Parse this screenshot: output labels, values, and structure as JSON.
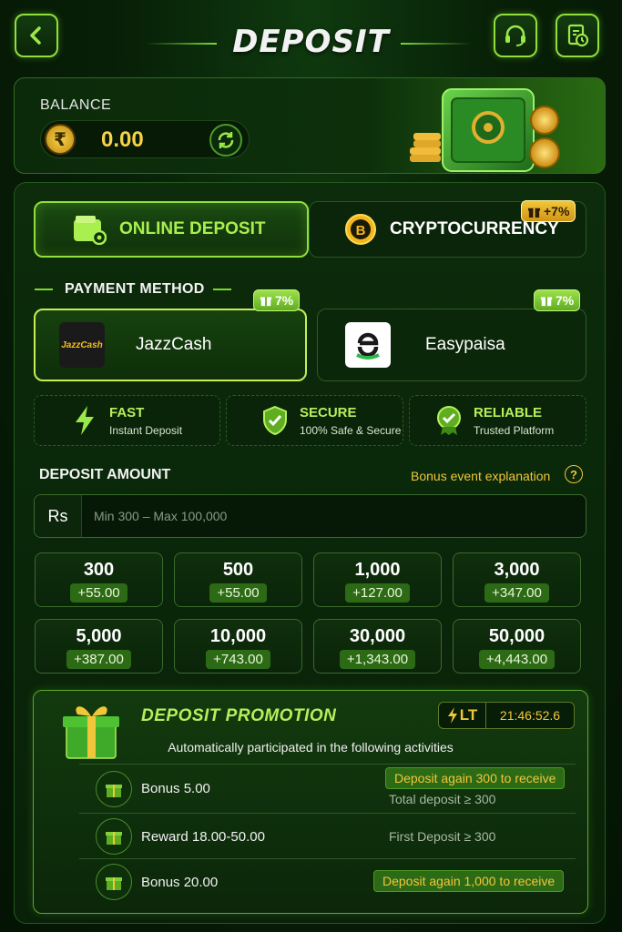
{
  "header": {
    "title": "DEPOSIT",
    "icons": {
      "back": "chevron-left-icon",
      "support": "headset-icon",
      "records": "document-clock-icon"
    }
  },
  "balance": {
    "label": "BALANCE",
    "value": "0.00",
    "currency_symbol": "₹"
  },
  "tabs": [
    {
      "label": "ONLINE DEPOSIT",
      "active": true
    },
    {
      "label": "CRYPTOCURRENCY",
      "active": false,
      "badge": "+7%"
    }
  ],
  "payment_method": {
    "title": "PAYMENT METHOD",
    "methods": [
      {
        "name": "JazzCash",
        "badge": "7%",
        "logo_text": "JazzCash",
        "selected": true
      },
      {
        "name": "Easypaisa",
        "badge": "7%",
        "selected": false
      }
    ]
  },
  "features": [
    {
      "title": "FAST",
      "subtitle": "Instant Deposit",
      "icon": "lightning-icon"
    },
    {
      "title": "SECURE",
      "subtitle": "100% Safe & Secure",
      "icon": "shield-check-icon"
    },
    {
      "title": "RELIABLE",
      "subtitle": "Trusted Platform",
      "icon": "badge-check-icon"
    }
  ],
  "deposit_amount": {
    "title": "DEPOSIT AMOUNT",
    "bonus_link": "Bonus event explanation",
    "help_symbol": "?",
    "currency_label": "Rs",
    "placeholder": "Min 300 – Max 100,000",
    "chips": [
      {
        "amount": "300",
        "bonus": "+55.00"
      },
      {
        "amount": "500",
        "bonus": "+55.00"
      },
      {
        "amount": "1,000",
        "bonus": "+127.00"
      },
      {
        "amount": "3,000",
        "bonus": "+347.00"
      },
      {
        "amount": "5,000",
        "bonus": "+387.00"
      },
      {
        "amount": "10,000",
        "bonus": "+743.00"
      },
      {
        "amount": "30,000",
        "bonus": "+1,343.00"
      },
      {
        "amount": "50,000",
        "bonus": "+4,443.00"
      }
    ]
  },
  "promotion": {
    "title": "DEPOSIT PROMOTION",
    "lt_label": "LT",
    "countdown": "21:46:52.6",
    "subtitle": "Automatically participated in the following activities",
    "rows": [
      {
        "label": "Bonus 5.00",
        "cta": "Deposit again 300 to receive",
        "condition": "Total deposit ≥ 300"
      },
      {
        "label": "Reward 18.00-50.00",
        "cta": "",
        "condition": "First Deposit ≥ 300"
      },
      {
        "label": "Bonus 20.00",
        "cta": "Deposit again 1,000 to receive",
        "condition": ""
      }
    ]
  },
  "colors": {
    "accent_green": "#8fe03a",
    "gold": "#f2c63a",
    "background": "#071f07"
  }
}
